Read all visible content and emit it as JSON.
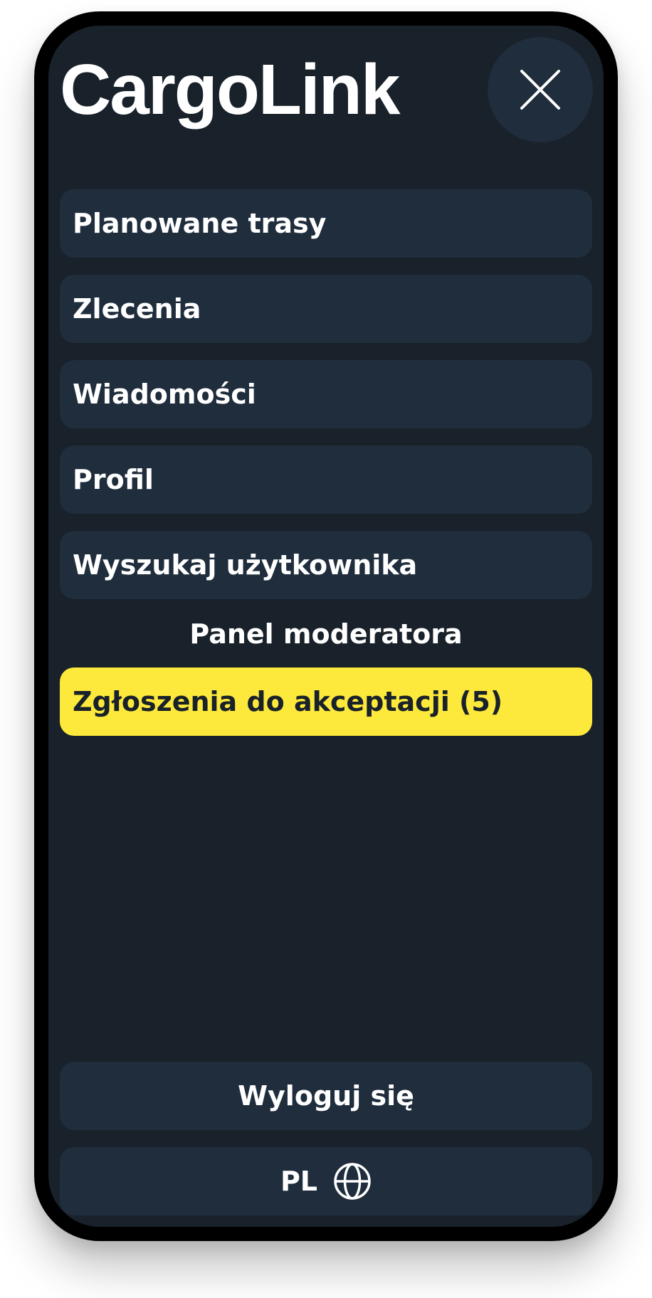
{
  "app": {
    "title": "CargoLink"
  },
  "menu": {
    "items": [
      {
        "label": "Planowane trasy"
      },
      {
        "label": "Zlecenia"
      },
      {
        "label": "Wiadomości"
      },
      {
        "label": "Profil"
      },
      {
        "label": "Wyszukaj użytkownika"
      }
    ],
    "moderator_section_title": "Panel moderatora",
    "moderator_items": [
      {
        "label": "Zgłoszenia do akceptacji (5)"
      }
    ]
  },
  "footer": {
    "logout_label": "Wyloguj się",
    "language_code": "PL"
  },
  "icons": {
    "close": "close-icon",
    "language": "globe-icon"
  },
  "colors": {
    "background": "#19212a",
    "card": "#1f2d3d",
    "accent": "#fde93b",
    "text": "#ffffff"
  }
}
